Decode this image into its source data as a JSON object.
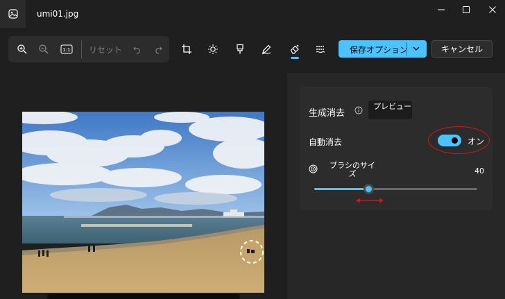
{
  "window": {
    "file_name": "umi01.jpg",
    "minimize": "—",
    "maximize": "☐",
    "close": "✕"
  },
  "toolbar": {
    "zoom_in_icon": "zoom-in-icon",
    "zoom_out_icon": "zoom-out-icon",
    "actual_size_label": "1:1",
    "reset_label": "リセット",
    "save_options_label": "保存オプション",
    "cancel_label": "キャンセル"
  },
  "erase_panel": {
    "title": "生成消去",
    "preview_badge": "プレビュー",
    "auto_erase_label": "自動消去",
    "auto_erase_state": "オン",
    "brush_size_label": "ブラシのサイズ",
    "brush_size_value": "40",
    "brush_size_fraction": 0.33
  },
  "colors": {
    "accent": "#4cc2ff",
    "annotation_red": "#d81414",
    "background": "#1f1f1f"
  }
}
